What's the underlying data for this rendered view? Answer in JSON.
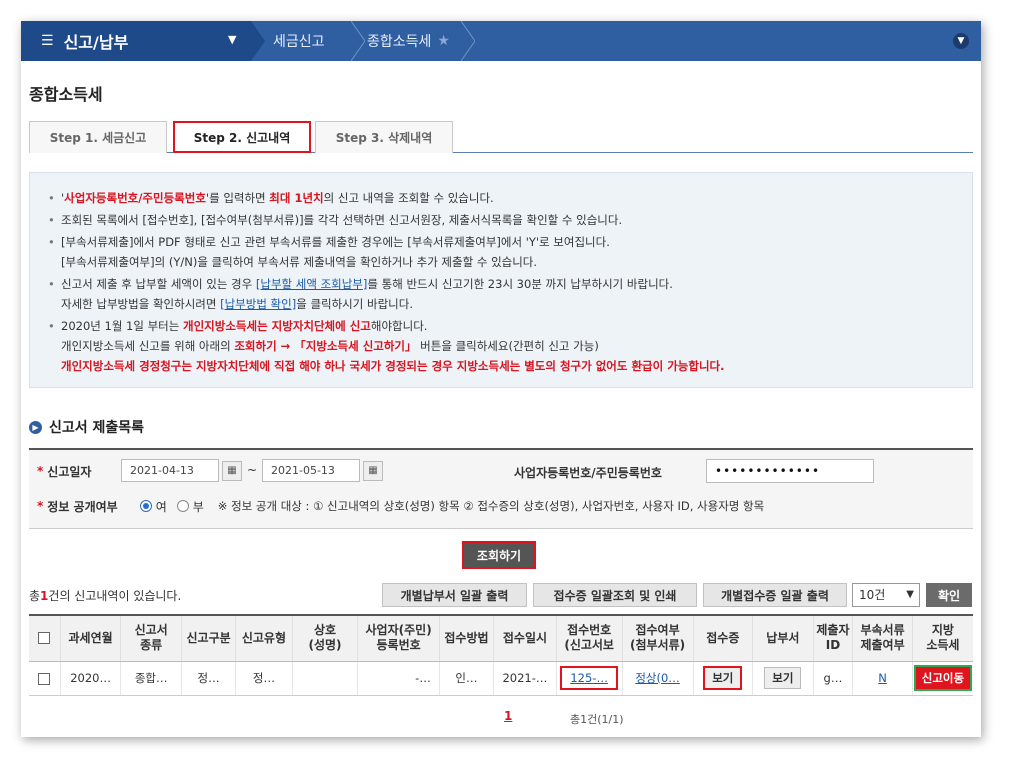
{
  "nav": {
    "menu_label": "신고/납부",
    "breadcrumbs": [
      "세금신고",
      "종합소득세"
    ]
  },
  "page_title": "종합소득세",
  "tabs": [
    {
      "label": "Step 1. 세금신고",
      "active": false
    },
    {
      "label": "Step 2. 신고내역",
      "active": true
    },
    {
      "label": "Step 3. 삭제내역",
      "active": false
    }
  ],
  "info": {
    "l1_a": "'",
    "l1_red1": "사업자등록번호/주민등록번호",
    "l1_b": "'를 입력하면 ",
    "l1_red2": "최대 1년치",
    "l1_c": "의 신고 내역을 조회할 수 있습니다.",
    "l2": "조회된 목록에서 [접수번호], [접수여부(첨부서류)]를 각각 선택하면 신고서원장, 제출서식목록을 확인할 수 있습니다.",
    "l3": "[부속서류제출]에서 PDF 형태로 신고 관련 부속서류를 제출한 경우에는 [부속서류제출여부]에서 'Y'로 보여집니다.",
    "l3b": "[부속서류제출여부]의 (Y/N)을 클릭하여 부속서류 제출내역을 확인하거나 추가 제출할 수 있습니다.",
    "l4_a": "신고서 제출 후 납부할 세액이 있는 경우 ",
    "l4_link": "[납부할 세액 조회납부]",
    "l4_b": "를 통해 반드시 신고기한 23시 30분 까지 납부하시기 바랍니다.",
    "l4b_a": "자세한 납부방법을 확인하시려면 ",
    "l4b_link": "[납부방법 확인]",
    "l4b_b": "을 클릭하시기 바랍니다.",
    "l5_a": "2020년 1월 1일 부터는 ",
    "l5_red": "개인지방소득세는 지방자치단체에 신고",
    "l5_b": "해야합니다.",
    "l5b_a": "개인지방소득세 신고를 위해 아래의 ",
    "l5b_red": "조회하기 → 「지방소득세 신고하기」",
    "l5b_b": " 버튼을 클릭하세요(간편히 신고 가능)",
    "l5c_red": "개인지방소득세 경정청구는 지방자치단체에 직접 해야 하나 국세가 경정되는 경우 지방소득세는 별도의 청구가 없어도 환급이 가능합니다."
  },
  "section_title": "신고서 제출목록",
  "search": {
    "date_label": "신고일자",
    "date_from": "2021-04-13",
    "tilde": "~",
    "date_to": "2021-05-13",
    "id_label": "사업자등록번호/주민등록번호",
    "id_value": "•••••••••••••",
    "disclose_label": "정보 공개여부",
    "opt_yes": "여",
    "opt_no": "부",
    "disclose_note": "※ 정보 공개 대상 : ① 신고내역의 상호(성명) 항목 ② 접수증의 상호(성명), 사업자번호, 사용자 ID, 사용자명 항목"
  },
  "query_button": "조회하기",
  "result_count": {
    "pre": "총",
    "num": "1",
    "post": "건의 신고내역이 있습니다."
  },
  "bulk_buttons": [
    "개별납부서 일괄 출력",
    "접수증 일괄조회 및 인쇄",
    "개별접수증 일괄 출력"
  ],
  "page_size": "10건",
  "confirm_button": "확인",
  "table": {
    "headers": [
      "과세연월",
      "신고서\n종류",
      "신고구분",
      "신고유형",
      "상호\n(성명)",
      "사업자(주민)\n등록번호",
      "접수방법",
      "접수일시",
      "접수번호\n(신고서보",
      "접수여부\n(첨부서류)",
      "접수증",
      "납부서",
      "제출자\nID",
      "부속서류\n제출여부",
      "지방\n소득세"
    ],
    "row": {
      "year_month": "2020…",
      "form_type": "종합…",
      "filing_div": "정…",
      "filing_type": "정…",
      "name": "",
      "reg_no": "-…",
      "method": "인…",
      "received_at": "2021-…",
      "receipt_no": "125-…",
      "status": "정상(0…",
      "receipt_btn": "보기",
      "payment_btn": "보기",
      "submitter": "g…",
      "attach": "N",
      "local_tax_btn": "신고이동"
    }
  },
  "pagination": {
    "current": "1",
    "info": "총1건(1/1)"
  }
}
